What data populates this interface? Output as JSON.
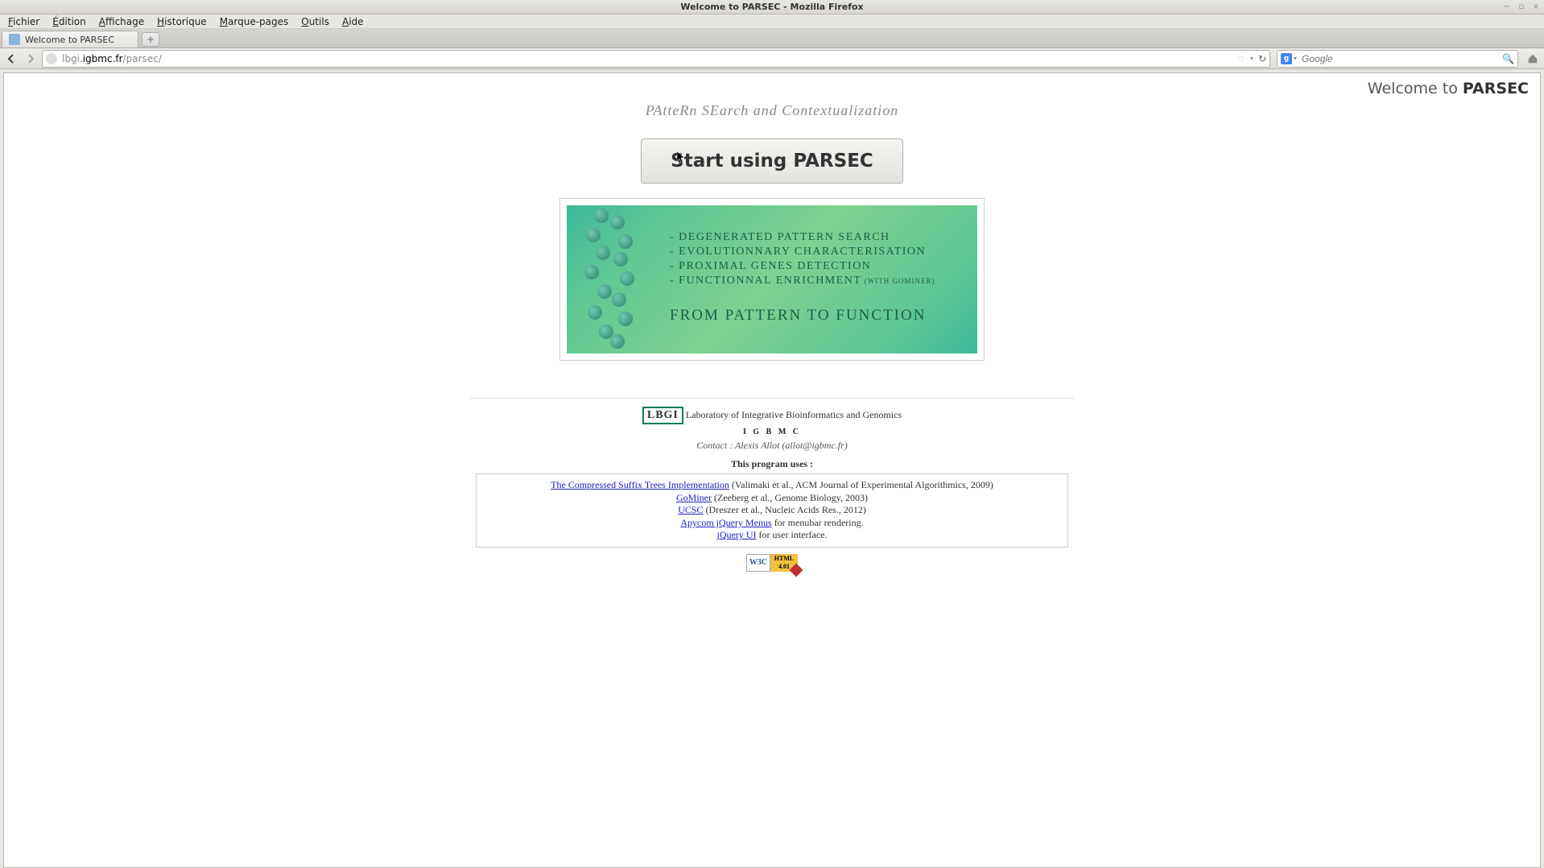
{
  "window": {
    "title": "Welcome to PARSEC - Mozilla Firefox"
  },
  "menubar": [
    "Fichier",
    "Édition",
    "Affichage",
    "Historique",
    "Marque-pages",
    "Outils",
    "Aide"
  ],
  "menubar_underline_index": [
    0,
    0,
    0,
    0,
    0,
    0,
    0
  ],
  "tab": {
    "title": "Welcome to PARSEC"
  },
  "url": {
    "prefix": "lbgi.",
    "domain": "igbmc.fr",
    "path": "/parsec/"
  },
  "search": {
    "placeholder": "Google",
    "engine_letter": "g"
  },
  "page_title_prefix": "Welcome to ",
  "page_title_bold": "PARSEC",
  "subheader": "PAtteRn SEarch and Contextualization",
  "start_button": "Start using PARSEC",
  "banner": {
    "lines": [
      "- DEGENERATED PATTERN SEARCH",
      "- EVOLUTIONNARY CHARACTERISATION",
      "- PROXIMAL GENES DETECTION",
      "- FUNCTIONNAL ENRICHMENT"
    ],
    "line4_suffix": " (WITH GOMINER)",
    "big": "FROM PATTERN TO FUNCTION"
  },
  "footer": {
    "lbgi": "LBGI",
    "lab": " Laboratory of Integrative Bioinformatics and Genomics",
    "igbmc": "I G B M C",
    "contact": "Contact : Alexis Allot (allot@igbmc.fr)",
    "uses": "This program uses :",
    "credits": [
      {
        "link": "The Compressed Suffix Trees Implementation",
        "rest": " (Valimaki et al., ACM Journal of Experimental Algorithmics, 2009)"
      },
      {
        "link": "GoMiner",
        "rest": " (Zeeberg et al., Genome Biology, 2003)"
      },
      {
        "link": "UCSC",
        "rest": " (Dreszer et al., Nucleic Acids Res., 2012)"
      },
      {
        "link": "Apycom jQuery Menus",
        "rest": " for menubar rendering."
      },
      {
        "link": "jQuery UI",
        "rest": " for user interface."
      }
    ],
    "w3c_left": "W3C",
    "w3c_right_top": "HTML",
    "w3c_right_bot": "4.01"
  }
}
